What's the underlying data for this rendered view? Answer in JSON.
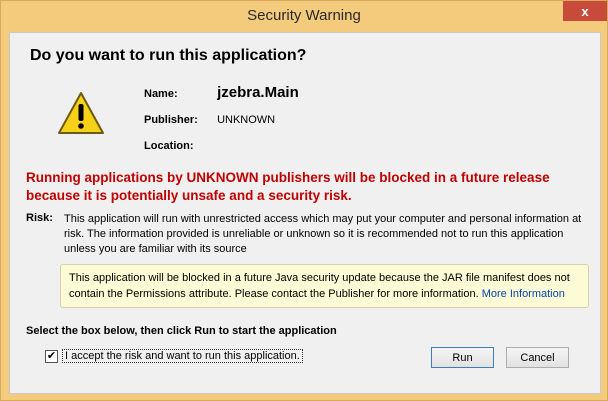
{
  "window": {
    "title": "Security Warning",
    "close_glyph": "x"
  },
  "dialog": {
    "heading": "Do you want to run this application?",
    "name_label": "Name:",
    "name_value": "jzebra.Main",
    "publisher_label": "Publisher:",
    "publisher_value": "UNKNOWN",
    "location_label": "Location:",
    "alert_text": "Running applications by UNKNOWN publishers will be blocked in a future release because it is potentially unsafe and a security risk.",
    "risk_label": "Risk:",
    "risk_text": "This application will run with unrestricted access which may put your computer and personal information at risk. The information provided is unreliable or unknown so it is recommended not to run this application unless you are familiar with its source",
    "notice_text": "This application will be blocked in a future Java security update because the JAR file manifest does not contain the Permissions attribute. Please contact the Publisher for more information.",
    "more_info_link": "More Information",
    "instruction": "Select the box below, then click Run to start the application",
    "checkbox_label": "I accept the risk and want to run this application.",
    "checkbox_checked": true,
    "run_button": "Run",
    "cancel_button": "Cancel"
  },
  "colors": {
    "titlebar": "#f4ca7c",
    "alert_red": "#c00000",
    "notice_bg": "#fdfbd5",
    "link": "#0645ad",
    "warning_yellow": "#f7d117"
  },
  "icons": {
    "warning": "warning-triangle-icon"
  }
}
